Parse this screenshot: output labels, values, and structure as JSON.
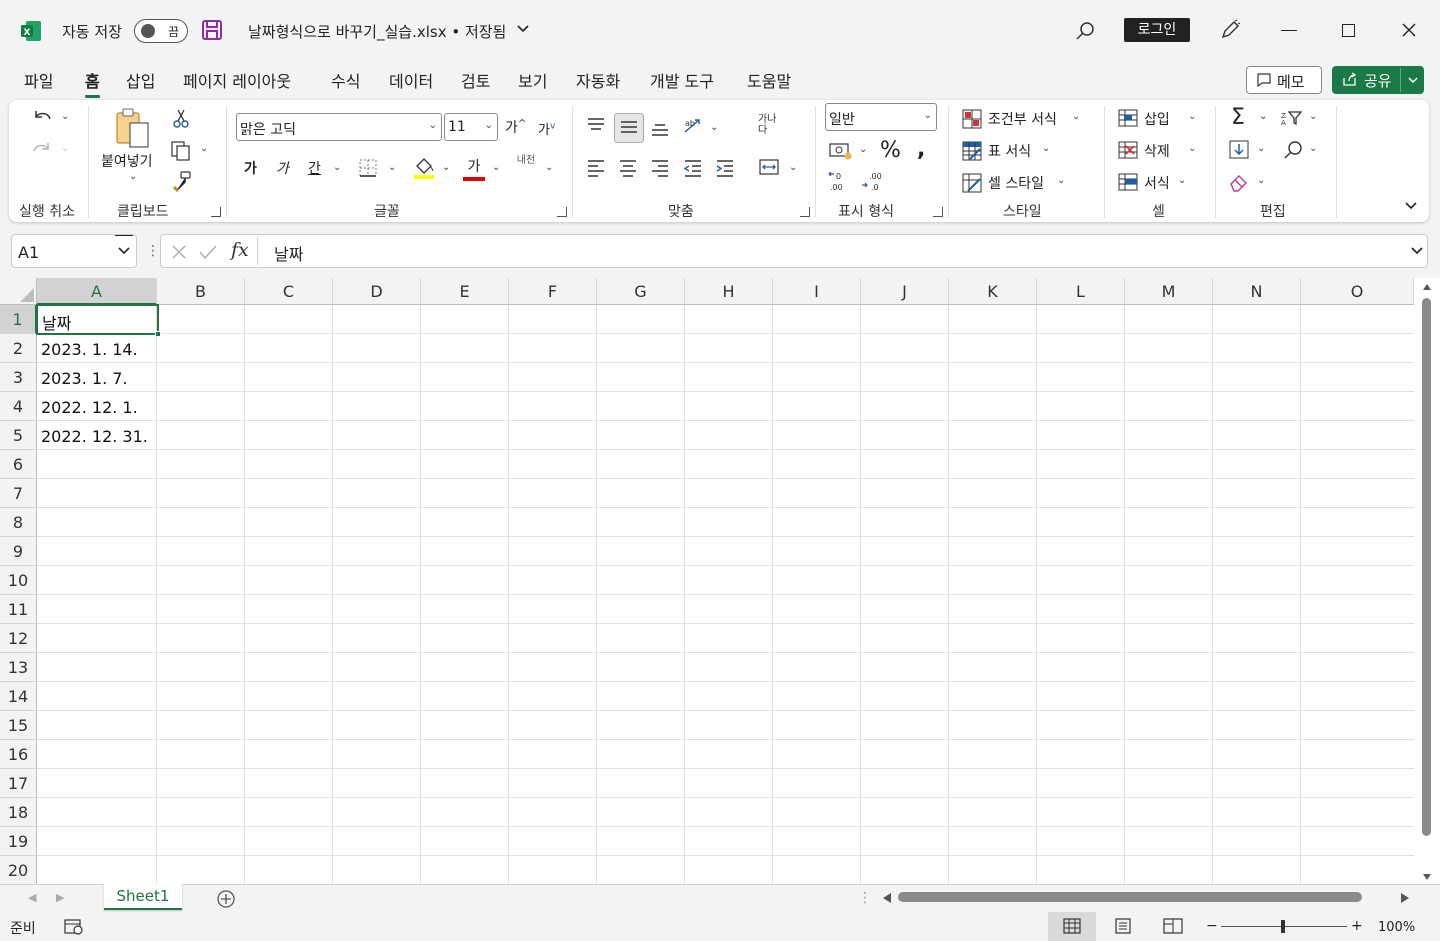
{
  "title_bar": {
    "autosave_label": "자동 저장",
    "autosave_state": "끔",
    "file_title": "날짜형식으로 바꾸기_실습.xlsx • 저장됨",
    "login_label": "로그인"
  },
  "menu": {
    "tabs": [
      "파일",
      "홈",
      "삽입",
      "페이지 레이아웃",
      "수식",
      "데이터",
      "검토",
      "보기",
      "자동화",
      "개발 도구",
      "도움말"
    ],
    "active": "홈",
    "memo_label": "메모",
    "share_label": "공유"
  },
  "ribbon": {
    "groups": {
      "undo": "실행 취소",
      "clipboard": "클립보드",
      "font": "글꼴",
      "alignment": "맞춤",
      "number": "표시 형식",
      "styles": "스타일",
      "cells": "셀",
      "editing": "편집"
    },
    "paste_label": "붙여넣기",
    "font_name": "맑은 고딕",
    "font_size": "11",
    "number_format": "일반",
    "conditional_format": "조건부 서식",
    "table_format": "표 서식",
    "cell_styles": "셀 스타일",
    "insert": "삽입",
    "delete": "삭제",
    "format": "서식",
    "bold": "가",
    "italic": "가",
    "underline": "간",
    "font_color_glyph": "가",
    "grow_font": "가",
    "shrink_font": "가",
    "phonetic": "내천",
    "wrap_text": "가나다",
    "accent_color": "#217346"
  },
  "formula_bar": {
    "name_box": "A1",
    "fx_label": "fx",
    "content": "날짜"
  },
  "grid": {
    "columns": [
      "A",
      "B",
      "C",
      "D",
      "E",
      "F",
      "G",
      "H",
      "I",
      "J",
      "K",
      "L",
      "M",
      "N",
      "O"
    ],
    "rows": [
      "1",
      "2",
      "3",
      "4",
      "5",
      "6",
      "7",
      "8",
      "9",
      "10",
      "11",
      "12",
      "13",
      "14",
      "15",
      "16",
      "17",
      "18",
      "19",
      "20"
    ],
    "cells": {
      "A1": "날짜",
      "A2": "2023. 1. 14.",
      "A3": "2023. 1. 7.",
      "A4": "2022. 12. 1.",
      "A5": "2022. 12. 31."
    },
    "selected_cell": "A1"
  },
  "sheets": {
    "tabs": [
      "Sheet1"
    ],
    "active": "Sheet1"
  },
  "status_bar": {
    "ready": "준비",
    "zoom": "100%"
  }
}
